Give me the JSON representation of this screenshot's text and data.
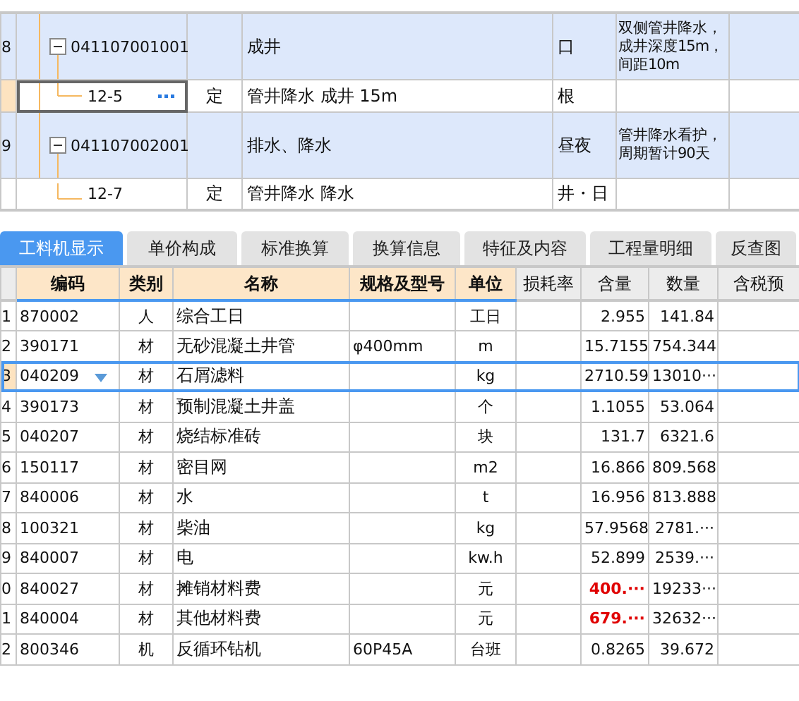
{
  "top_rows": [
    {
      "kind": "item",
      "row_number": "8",
      "code": "041107001001",
      "type": "",
      "name": "成井",
      "unit": "口",
      "feature": "双侧管井降水，成井深度15m，间距10m",
      "selected": false
    },
    {
      "kind": "quota",
      "row_number": "",
      "code": "12-5",
      "type": "定",
      "name": "管井降水 成井 15m",
      "unit": "根",
      "feature": "",
      "selected": true
    },
    {
      "kind": "item",
      "row_number": "9",
      "code": "041107002001",
      "type": "",
      "name": "排水、降水",
      "unit": "昼夜",
      "feature": "管井降水看护，周期暂计90天",
      "selected": false
    },
    {
      "kind": "quota",
      "row_number": "",
      "code": "12-7",
      "type": "定",
      "name": "管井降水 降水",
      "unit": "井・日",
      "feature": "",
      "selected": false
    }
  ],
  "tabs": [
    {
      "label": "工料机显示",
      "selected": true
    },
    {
      "label": "单价构成",
      "selected": false
    },
    {
      "label": "标准换算",
      "selected": false
    },
    {
      "label": "换算信息",
      "selected": false
    },
    {
      "label": "特征及内容",
      "selected": false
    },
    {
      "label": "工程量明细",
      "selected": false
    },
    {
      "label": "反查图",
      "selected": false
    }
  ],
  "columns": [
    {
      "label": "编码",
      "highlighted": true
    },
    {
      "label": "类别",
      "highlighted": true
    },
    {
      "label": "名称",
      "highlighted": true
    },
    {
      "label": "规格及型号",
      "highlighted": true
    },
    {
      "label": "单位",
      "highlighted": true
    },
    {
      "label": "损耗率",
      "highlighted": false
    },
    {
      "label": "含量",
      "highlighted": false
    },
    {
      "label": "数量",
      "highlighted": false
    },
    {
      "label": "含税预",
      "highlighted": false
    }
  ],
  "rows": [
    {
      "row_number": "1",
      "code": "870002",
      "type": "人",
      "name": "综合工日",
      "spec": "",
      "unit": "工日",
      "content": "2.955",
      "content_warning": false,
      "quantity": "141.84",
      "selected": false
    },
    {
      "row_number": "2",
      "code": "390171",
      "type": "材",
      "name": "无砂混凝土井管",
      "spec": "φ400mm",
      "unit": "m",
      "content": "15.7155",
      "content_warning": false,
      "quantity": "754.344",
      "selected": false
    },
    {
      "row_number": "3",
      "code": "040209",
      "type": "材",
      "name": "石屑滤料",
      "spec": "",
      "unit": "kg",
      "content": "2710.59",
      "content_warning": false,
      "quantity": "13010···",
      "selected": true
    },
    {
      "row_number": "4",
      "code": "390173",
      "type": "材",
      "name": "预制混凝土井盖",
      "spec": "",
      "unit": "个",
      "content": "1.1055",
      "content_warning": false,
      "quantity": "53.064",
      "selected": false
    },
    {
      "row_number": "5",
      "code": "040207",
      "type": "材",
      "name": "烧结标准砖",
      "spec": "",
      "unit": "块",
      "content": "131.7",
      "content_warning": false,
      "quantity": "6321.6",
      "selected": false
    },
    {
      "row_number": "6",
      "code": "150117",
      "type": "材",
      "name": "密目网",
      "spec": "",
      "unit": "m2",
      "content": "16.866",
      "content_warning": false,
      "quantity": "809.568",
      "selected": false
    },
    {
      "row_number": "7",
      "code": "840006",
      "type": "材",
      "name": "水",
      "spec": "",
      "unit": "t",
      "content": "16.956",
      "content_warning": false,
      "quantity": "813.888",
      "selected": false
    },
    {
      "row_number": "8",
      "code": "100321",
      "type": "材",
      "name": "柴油",
      "spec": "",
      "unit": "kg",
      "content": "57.9568",
      "content_warning": false,
      "quantity": "2781.···",
      "selected": false
    },
    {
      "row_number": "9",
      "code": "840007",
      "type": "材",
      "name": "电",
      "spec": "",
      "unit": "kw.h",
      "content": "52.899",
      "content_warning": false,
      "quantity": "2539.···",
      "selected": false
    },
    {
      "row_number": "0",
      "code": "840027",
      "type": "材",
      "name": "摊销材料费",
      "spec": "",
      "unit": "元",
      "content": "400.···",
      "content_warning": true,
      "quantity": "19233···",
      "selected": false
    },
    {
      "row_number": "1",
      "code": "840004",
      "type": "材",
      "name": "其他材料费",
      "spec": "",
      "unit": "元",
      "content": "679.···",
      "content_warning": true,
      "quantity": "32632···",
      "selected": false
    },
    {
      "row_number": "2",
      "code": "800346",
      "type": "机",
      "name": "反循环钻机",
      "spec": "60P45A",
      "unit": "台班",
      "content": "0.8265",
      "content_warning": false,
      "quantity": "39.672",
      "selected": false
    }
  ]
}
